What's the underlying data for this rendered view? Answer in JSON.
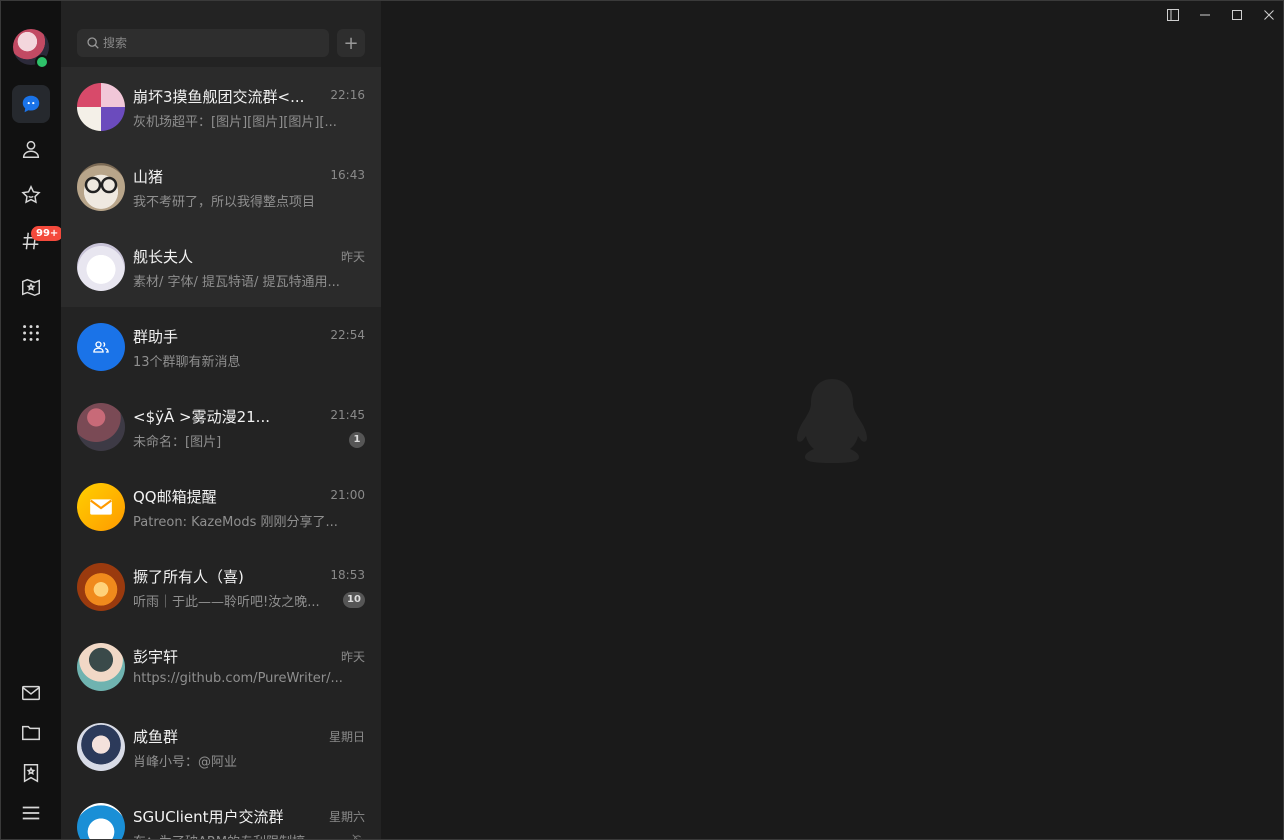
{
  "search": {
    "placeholder": "搜索"
  },
  "add_label": "+",
  "nav": {
    "badge": "99+"
  },
  "chats": [
    {
      "name": "崩坏3摸鱼舰团交流群<...",
      "time": "22:16",
      "msg": "灰机场超平：[图片][图片][图片][...",
      "unread": "",
      "muted": false,
      "avatar": "anime-group-avatar"
    },
    {
      "name": "山猪",
      "time": "16:43",
      "msg": "我不考研了，所以我得整点项目",
      "unread": "",
      "muted": false,
      "avatar": "glasses-character-avatar"
    },
    {
      "name": "舰长夫人",
      "time": "昨天",
      "msg": "素材/ 字体/ 提瓦特语/ 提瓦特通用...",
      "unread": "",
      "muted": false,
      "avatar": "white-hair-girl-avatar"
    },
    {
      "name": "群助手",
      "time": "22:54",
      "msg": "13个群聊有新消息",
      "unread": "",
      "muted": false,
      "avatar": "group-assistant-icon"
    },
    {
      "name": "<$ÿĀ          >雾动漫21...",
      "time": "21:45",
      "msg": "未命名：[图片]",
      "unread": "1",
      "muted": false,
      "avatar": "flower-avatar"
    },
    {
      "name": "QQ邮箱提醒",
      "time": "21:00",
      "msg": "Patreon: KazeMods 刚刚分享了...",
      "unread": "",
      "muted": false,
      "avatar": "mail-envelope-icon"
    },
    {
      "name": "撅了所有人（喜)",
      "time": "18:53",
      "msg": "听雨｜于此——聆听吧!汝之晚...",
      "unread": "10",
      "muted": false,
      "avatar": "fire-avatar"
    },
    {
      "name": "彭宇轩",
      "time": "昨天",
      "msg": "https://github.com/PureWriter/...",
      "unread": "",
      "muted": false,
      "avatar": "boy-anime-avatar"
    },
    {
      "name": "咸鱼群",
      "time": "星期日",
      "msg": "肖峰小号：@阿业",
      "unread": "",
      "muted": false,
      "avatar": "girl-anime-avatar"
    },
    {
      "name": "SGUClient用户交流群",
      "time": "星期六",
      "msg": "东：为了破ARM的专利限制搞...",
      "unread": "",
      "muted": true,
      "avatar": "doraemon-avatar"
    }
  ],
  "colors": {
    "accent": "#1a73e8",
    "badge": "#f44a3c",
    "online": "#2ec26a"
  }
}
